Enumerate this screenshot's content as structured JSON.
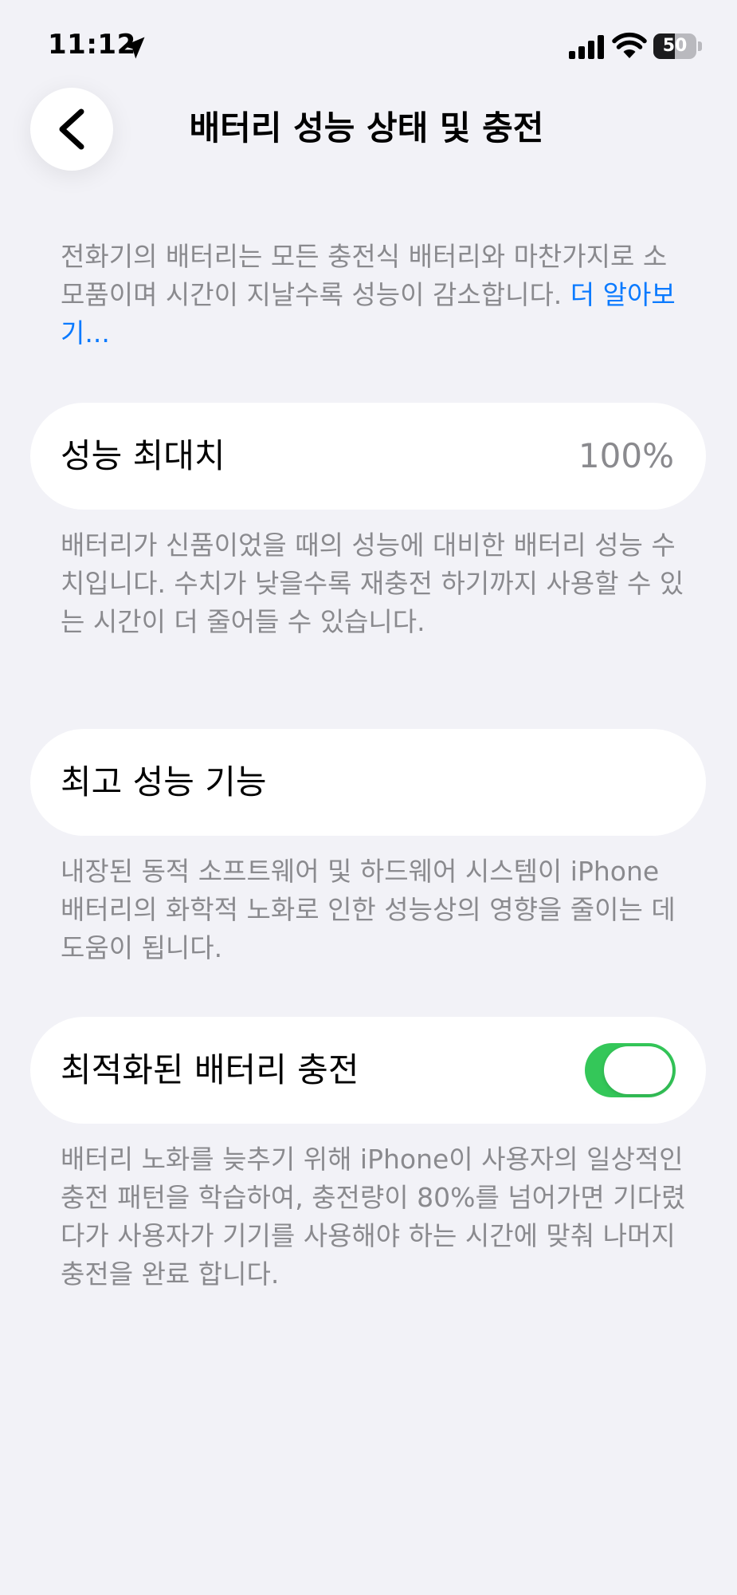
{
  "status_bar": {
    "time": "11:12",
    "battery_level": "50",
    "battery_fraction": 0.5,
    "icons": [
      "location-arrow-icon",
      "cellular-signal-icon",
      "wifi-icon",
      "battery-icon"
    ]
  },
  "nav": {
    "title": "배터리 성능 상태 및 충전",
    "back_icon": "chevron-left-icon"
  },
  "intro": {
    "text": "전화기의 배터리는 모든 충전식 배터리와 마찬가지로 소모품이며 시간이 지날수록 성능이 감소합니다. ",
    "link": "더 알아보기..."
  },
  "maximum_capacity": {
    "label": "성능 최대치",
    "value": "100%",
    "footnote": "배터리가 신품이었을 때의 성능에 대비한 배터리 성능 수치입니다. 수치가 낮을수록 재충전 하기까지 사용할 수 있는 시간이 더 줄어들 수 있습니다."
  },
  "peak_performance": {
    "label": "최고 성능 기능",
    "footnote": "내장된 동적 소프트웨어 및 하드웨어 시스템이 iPhone 배터리의 화학적 노화로 인한 성능상의 영향을 줄이는 데 도움이 됩니다."
  },
  "optimized_charging": {
    "label": "최적화된 배터리 충전",
    "enabled": true,
    "footnote": "배터리 노화를 늦추기 위해 iPhone이 사용자의 일상적인 충전 패턴을 학습하여, 충전량이 80%를 넘어가면 기다렸다가 사용자가 기기를 사용해야 하는 시간에 맞춰 나머지 충전을 완료 합니다."
  },
  "colors": {
    "background": "#f2f2f7",
    "link": "#0a7aff",
    "toggle_on": "#34c759",
    "secondary_text": "#8a8a8e"
  }
}
